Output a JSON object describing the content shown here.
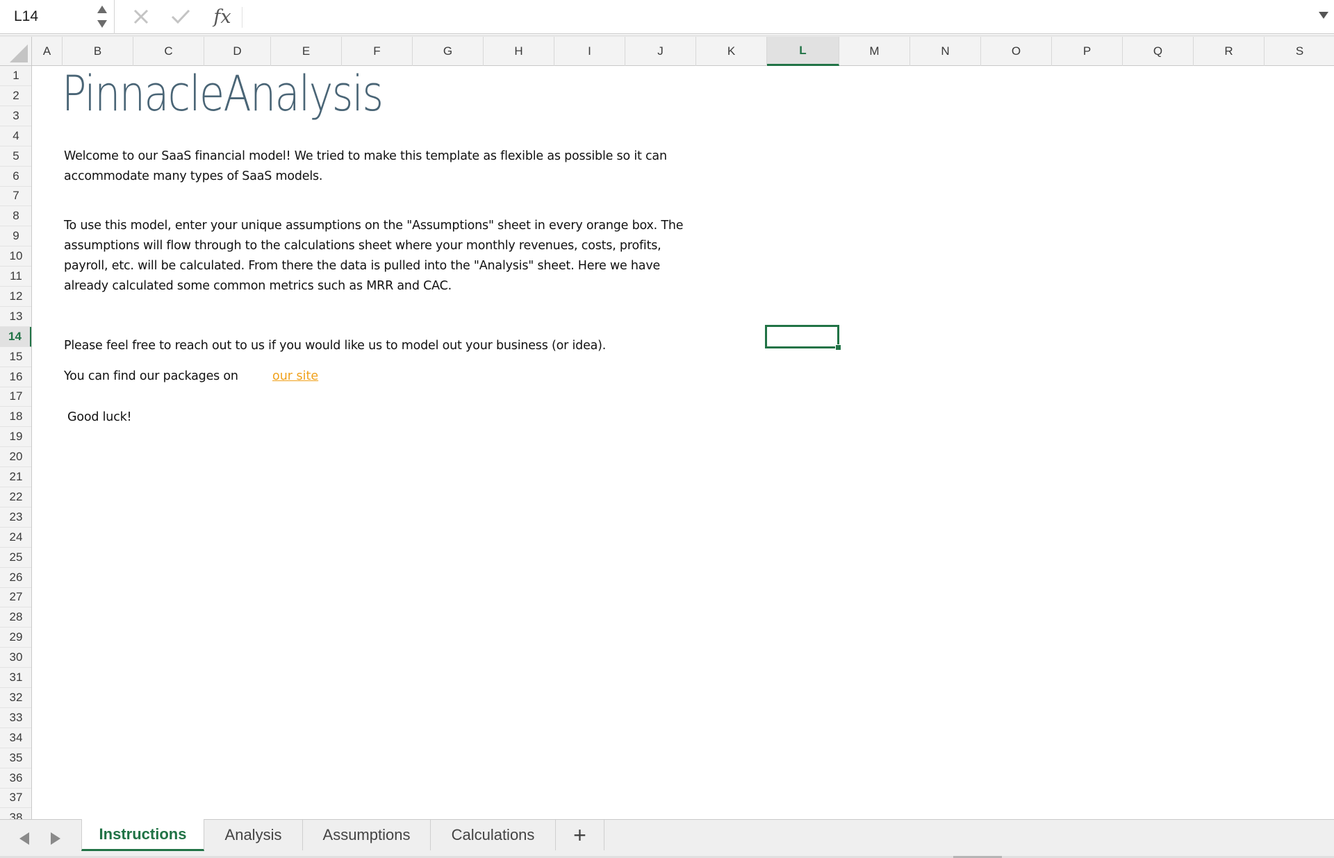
{
  "formula_bar": {
    "name_box": "L14",
    "fx_label": "fx",
    "formula_value": ""
  },
  "columns": [
    "A",
    "B",
    "C",
    "D",
    "E",
    "F",
    "G",
    "H",
    "I",
    "J",
    "K",
    "L",
    "M",
    "N",
    "O",
    "P",
    "Q",
    "R",
    "S"
  ],
  "active_column": "L",
  "rows": [
    "1",
    "2",
    "3",
    "4",
    "5",
    "6",
    "7",
    "8",
    "9",
    "10",
    "11",
    "12",
    "13",
    "14",
    "15",
    "16",
    "17",
    "18",
    "19",
    "20",
    "21",
    "22",
    "23",
    "24",
    "25",
    "26",
    "27",
    "28",
    "29",
    "30",
    "31",
    "32",
    "33",
    "34",
    "35",
    "36",
    "37",
    "38"
  ],
  "active_row": "14",
  "sheet": {
    "logo_text": "PinnacleAnalysis",
    "welcome_line1": "Welcome to our SaaS financial model! We tried to make this template as flexible as possible so it can",
    "welcome_line2": "accommodate many types of SaaS models.",
    "usage_line1": "To use this model, enter your unique assumptions on the \"Assumptions\" sheet in every orange box. The",
    "usage_line2": "assumptions will flow through to the calculations sheet where your monthly revenues, costs, profits,",
    "usage_line3": "payroll, etc. will be calculated. From there the data is pulled into the \"Analysis\" sheet. Here we have",
    "usage_line4": "already calculated some common metrics such as MRR and CAC.",
    "contact_line": "Please feel free to reach out to us if you would like us to model out your business (or idea).",
    "packages_text": "You can find our packages on",
    "packages_link": "our site",
    "closing": "Good luck!"
  },
  "tabs": [
    {
      "label": "Instructions",
      "active": true
    },
    {
      "label": "Analysis",
      "active": false
    },
    {
      "label": "Assumptions",
      "active": false
    },
    {
      "label": "Calculations",
      "active": false
    }
  ],
  "add_sheet_label": "+",
  "colors": {
    "accent_green": "#217346",
    "link_orange": "#f0a11b",
    "logo_slate": "#4a6576"
  }
}
